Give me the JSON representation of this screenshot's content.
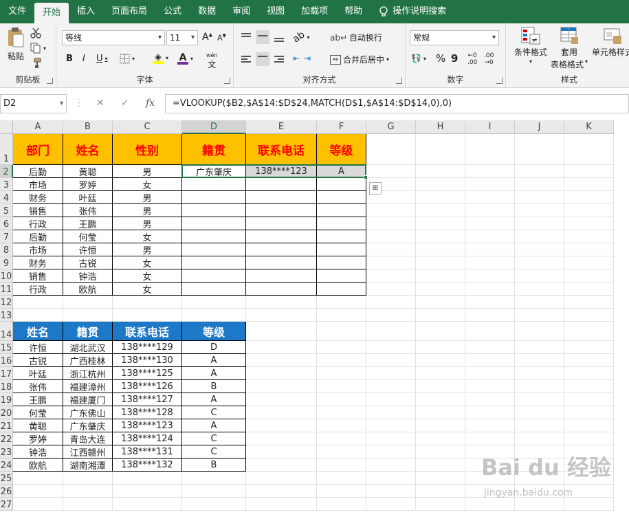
{
  "tabs": [
    "文件",
    "开始",
    "插入",
    "页面布局",
    "公式",
    "数据",
    "审阅",
    "视图",
    "加载项",
    "帮助"
  ],
  "active_tab": 1,
  "search_label": "操作说明搜索",
  "ribbon": {
    "clipboard": {
      "paste": "粘贴",
      "label": "剪贴板"
    },
    "font": {
      "name": "等线",
      "size": "11",
      "bold": "B",
      "italic": "I",
      "underline": "U",
      "label": "字体",
      "font_color_glyph": "A",
      "phonetic": "wén"
    },
    "align": {
      "wrap": "自动换行",
      "merge": "合并后居中",
      "label": "对齐方式"
    },
    "number": {
      "format": "常规",
      "percent": "%",
      "comma": "9",
      "label": "数字"
    },
    "styles": {
      "cond": "条件格式",
      "table_a": "套用",
      "table_b": "表格格式",
      "cell": "单元格样式",
      "label": "样式"
    }
  },
  "formula_bar": {
    "name_box": "D2",
    "formula": "=VLOOKUP($B2,$A$14:$D$24,MATCH(D$1,$A$14:$D$14,0),0)",
    "fx": "fx"
  },
  "columns": [
    "A",
    "B",
    "C",
    "D",
    "E",
    "F",
    "G",
    "H",
    "I",
    "J",
    "K"
  ],
  "rows": [
    "1",
    "2",
    "3",
    "4",
    "5",
    "6",
    "7",
    "8",
    "9",
    "10",
    "11",
    "12",
    "13",
    "14",
    "15",
    "16",
    "17",
    "18",
    "19",
    "20",
    "21",
    "22",
    "23",
    "24",
    "25",
    "26",
    "27"
  ],
  "table1": {
    "headers": [
      "部门",
      "姓名",
      "性别",
      "籍贯",
      "联系电话",
      "等级"
    ],
    "rows": [
      [
        "后勤",
        "黄聪",
        "男",
        "广东肇庆",
        "138****123",
        "A"
      ],
      [
        "市场",
        "罗婷",
        "女",
        "",
        "",
        ""
      ],
      [
        "财务",
        "叶廷",
        "男",
        "",
        "",
        ""
      ],
      [
        "销售",
        "张伟",
        "男",
        "",
        "",
        ""
      ],
      [
        "行政",
        "王鹏",
        "男",
        "",
        "",
        ""
      ],
      [
        "后勤",
        "何莹",
        "女",
        "",
        "",
        ""
      ],
      [
        "市场",
        "许恒",
        "男",
        "",
        "",
        ""
      ],
      [
        "财务",
        "古锐",
        "女",
        "",
        "",
        ""
      ],
      [
        "销售",
        "钟浩",
        "女",
        "",
        "",
        ""
      ],
      [
        "行政",
        "欧航",
        "女",
        "",
        "",
        ""
      ]
    ]
  },
  "table2": {
    "headers": [
      "姓名",
      "籍贯",
      "联系电话",
      "等级"
    ],
    "rows": [
      [
        "许恒",
        "湖北武汉",
        "138****129",
        "D"
      ],
      [
        "古锐",
        "广西桂林",
        "138****130",
        "A"
      ],
      [
        "叶廷",
        "浙江杭州",
        "138****125",
        "A"
      ],
      [
        "张伟",
        "福建漳州",
        "138****126",
        "B"
      ],
      [
        "王鹏",
        "福建厦门",
        "138****127",
        "A"
      ],
      [
        "何莹",
        "广东佛山",
        "138****128",
        "C"
      ],
      [
        "黄聪",
        "广东肇庆",
        "138****123",
        "A"
      ],
      [
        "罗婷",
        "青岛大连",
        "138****124",
        "C"
      ],
      [
        "钟浩",
        "江西赣州",
        "138****131",
        "C"
      ],
      [
        "欧航",
        "湖南湘潭",
        "138****132",
        "B"
      ]
    ]
  },
  "watermark": {
    "logo": "Bai du 经验",
    "url": "jingyan.baidu.com"
  },
  "colors": {
    "excel_green": "#217346",
    "header_orange": "#ffc000",
    "header_red": "#ff0000",
    "header_blue": "#1e78c8"
  }
}
